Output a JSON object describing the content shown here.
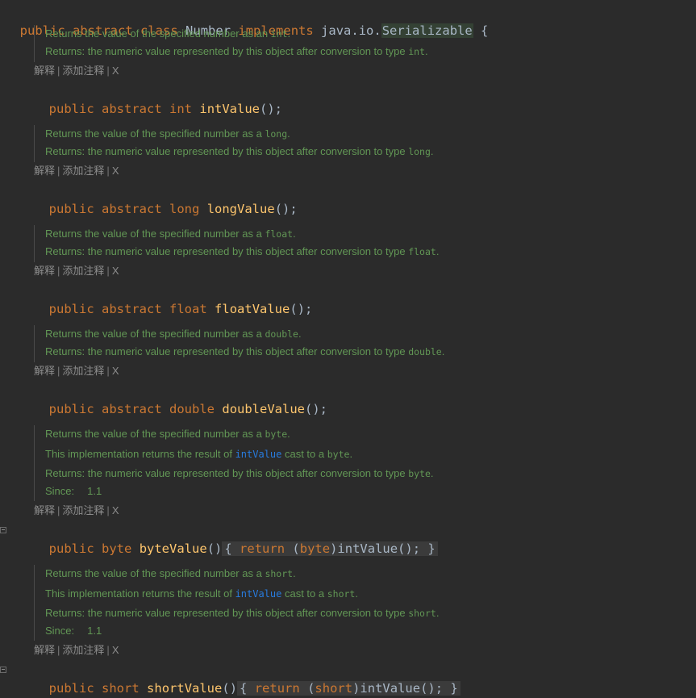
{
  "class_decl": {
    "kw_public": "public",
    "kw_abstract": "abstract",
    "kw_class": "class",
    "name": "Number",
    "kw_implements": "implements",
    "pkg": "java.io.",
    "iface": "Serializable",
    "brace": "{"
  },
  "annotation": {
    "explain": "解释",
    "add_note": "添加注释",
    "close": "X",
    "sep": "|"
  },
  "methods": [
    {
      "doc_summary_prefix": "Returns the value of the specified number as an ",
      "doc_summary_code": "int",
      "doc_summary_suffix": ".",
      "doc_returns_prefix": "Returns: the numeric value represented by this object after conversion to type ",
      "doc_returns_code": "int",
      "doc_returns_suffix": ".",
      "kw_public": "public",
      "kw_abstract": "abstract",
      "type": "int",
      "name": "intValue",
      "tail": "();"
    },
    {
      "doc_summary_prefix": "Returns the value of the specified number as a ",
      "doc_summary_code": "long",
      "doc_summary_suffix": ".",
      "doc_returns_prefix": "Returns: the numeric value represented by this object after conversion to type ",
      "doc_returns_code": "long",
      "doc_returns_suffix": ".",
      "kw_public": "public",
      "kw_abstract": "abstract",
      "type": "long",
      "name": "longValue",
      "tail": "();"
    },
    {
      "doc_summary_prefix": "Returns the value of the specified number as a ",
      "doc_summary_code": "float",
      "doc_summary_suffix": ".",
      "doc_returns_prefix": "Returns: the numeric value represented by this object after conversion to type ",
      "doc_returns_code": "float",
      "doc_returns_suffix": ".",
      "kw_public": "public",
      "kw_abstract": "abstract",
      "type": "float",
      "name": "floatValue",
      "tail": "();"
    },
    {
      "doc_summary_prefix": "Returns the value of the specified number as a ",
      "doc_summary_code": "double",
      "doc_summary_suffix": ".",
      "doc_returns_prefix": "Returns: the numeric value represented by this object after conversion to type ",
      "doc_returns_code": "double",
      "doc_returns_suffix": ".",
      "kw_public": "public",
      "kw_abstract": "abstract",
      "type": "double",
      "name": "doubleValue",
      "tail": "();"
    },
    {
      "doc_summary_prefix": "Returns the value of the specified number as a ",
      "doc_summary_code": "byte",
      "doc_summary_suffix": ".",
      "doc_impl_prefix": "This implementation returns the result of ",
      "doc_impl_link": "intValue",
      "doc_impl_mid": " cast to a ",
      "doc_impl_code": "byte",
      "doc_impl_suffix": ".",
      "doc_returns_prefix": "Returns: the numeric value represented by this object after conversion to type ",
      "doc_returns_code": "byte",
      "doc_returns_suffix": ".",
      "since_label": "Since:",
      "since_value": "1.1",
      "kw_public": "public",
      "type": "byte",
      "name": "byteValue",
      "parens": "()",
      "brace_open": "{",
      "kw_return": "return",
      "cast_open": "(",
      "cast_type": "byte",
      "cast_close": ")",
      "call": "intValue();",
      "brace_close": "}"
    },
    {
      "doc_summary_prefix": "Returns the value of the specified number as a ",
      "doc_summary_code": "short",
      "doc_summary_suffix": ".",
      "doc_impl_prefix": "This implementation returns the result of ",
      "doc_impl_link": "intValue",
      "doc_impl_mid": " cast to a ",
      "doc_impl_code": "short",
      "doc_impl_suffix": ".",
      "doc_returns_prefix": "Returns: the numeric value represented by this object after conversion to type ",
      "doc_returns_code": "short",
      "doc_returns_suffix": ".",
      "since_label": "Since:",
      "since_value": "1.1",
      "kw_public": "public",
      "type": "short",
      "name": "shortValue",
      "parens": "()",
      "brace_open": "{",
      "kw_return": "return",
      "cast_open": "(",
      "cast_type": "short",
      "cast_close": ")",
      "call": "intValue();",
      "brace_close": "}"
    }
  ]
}
